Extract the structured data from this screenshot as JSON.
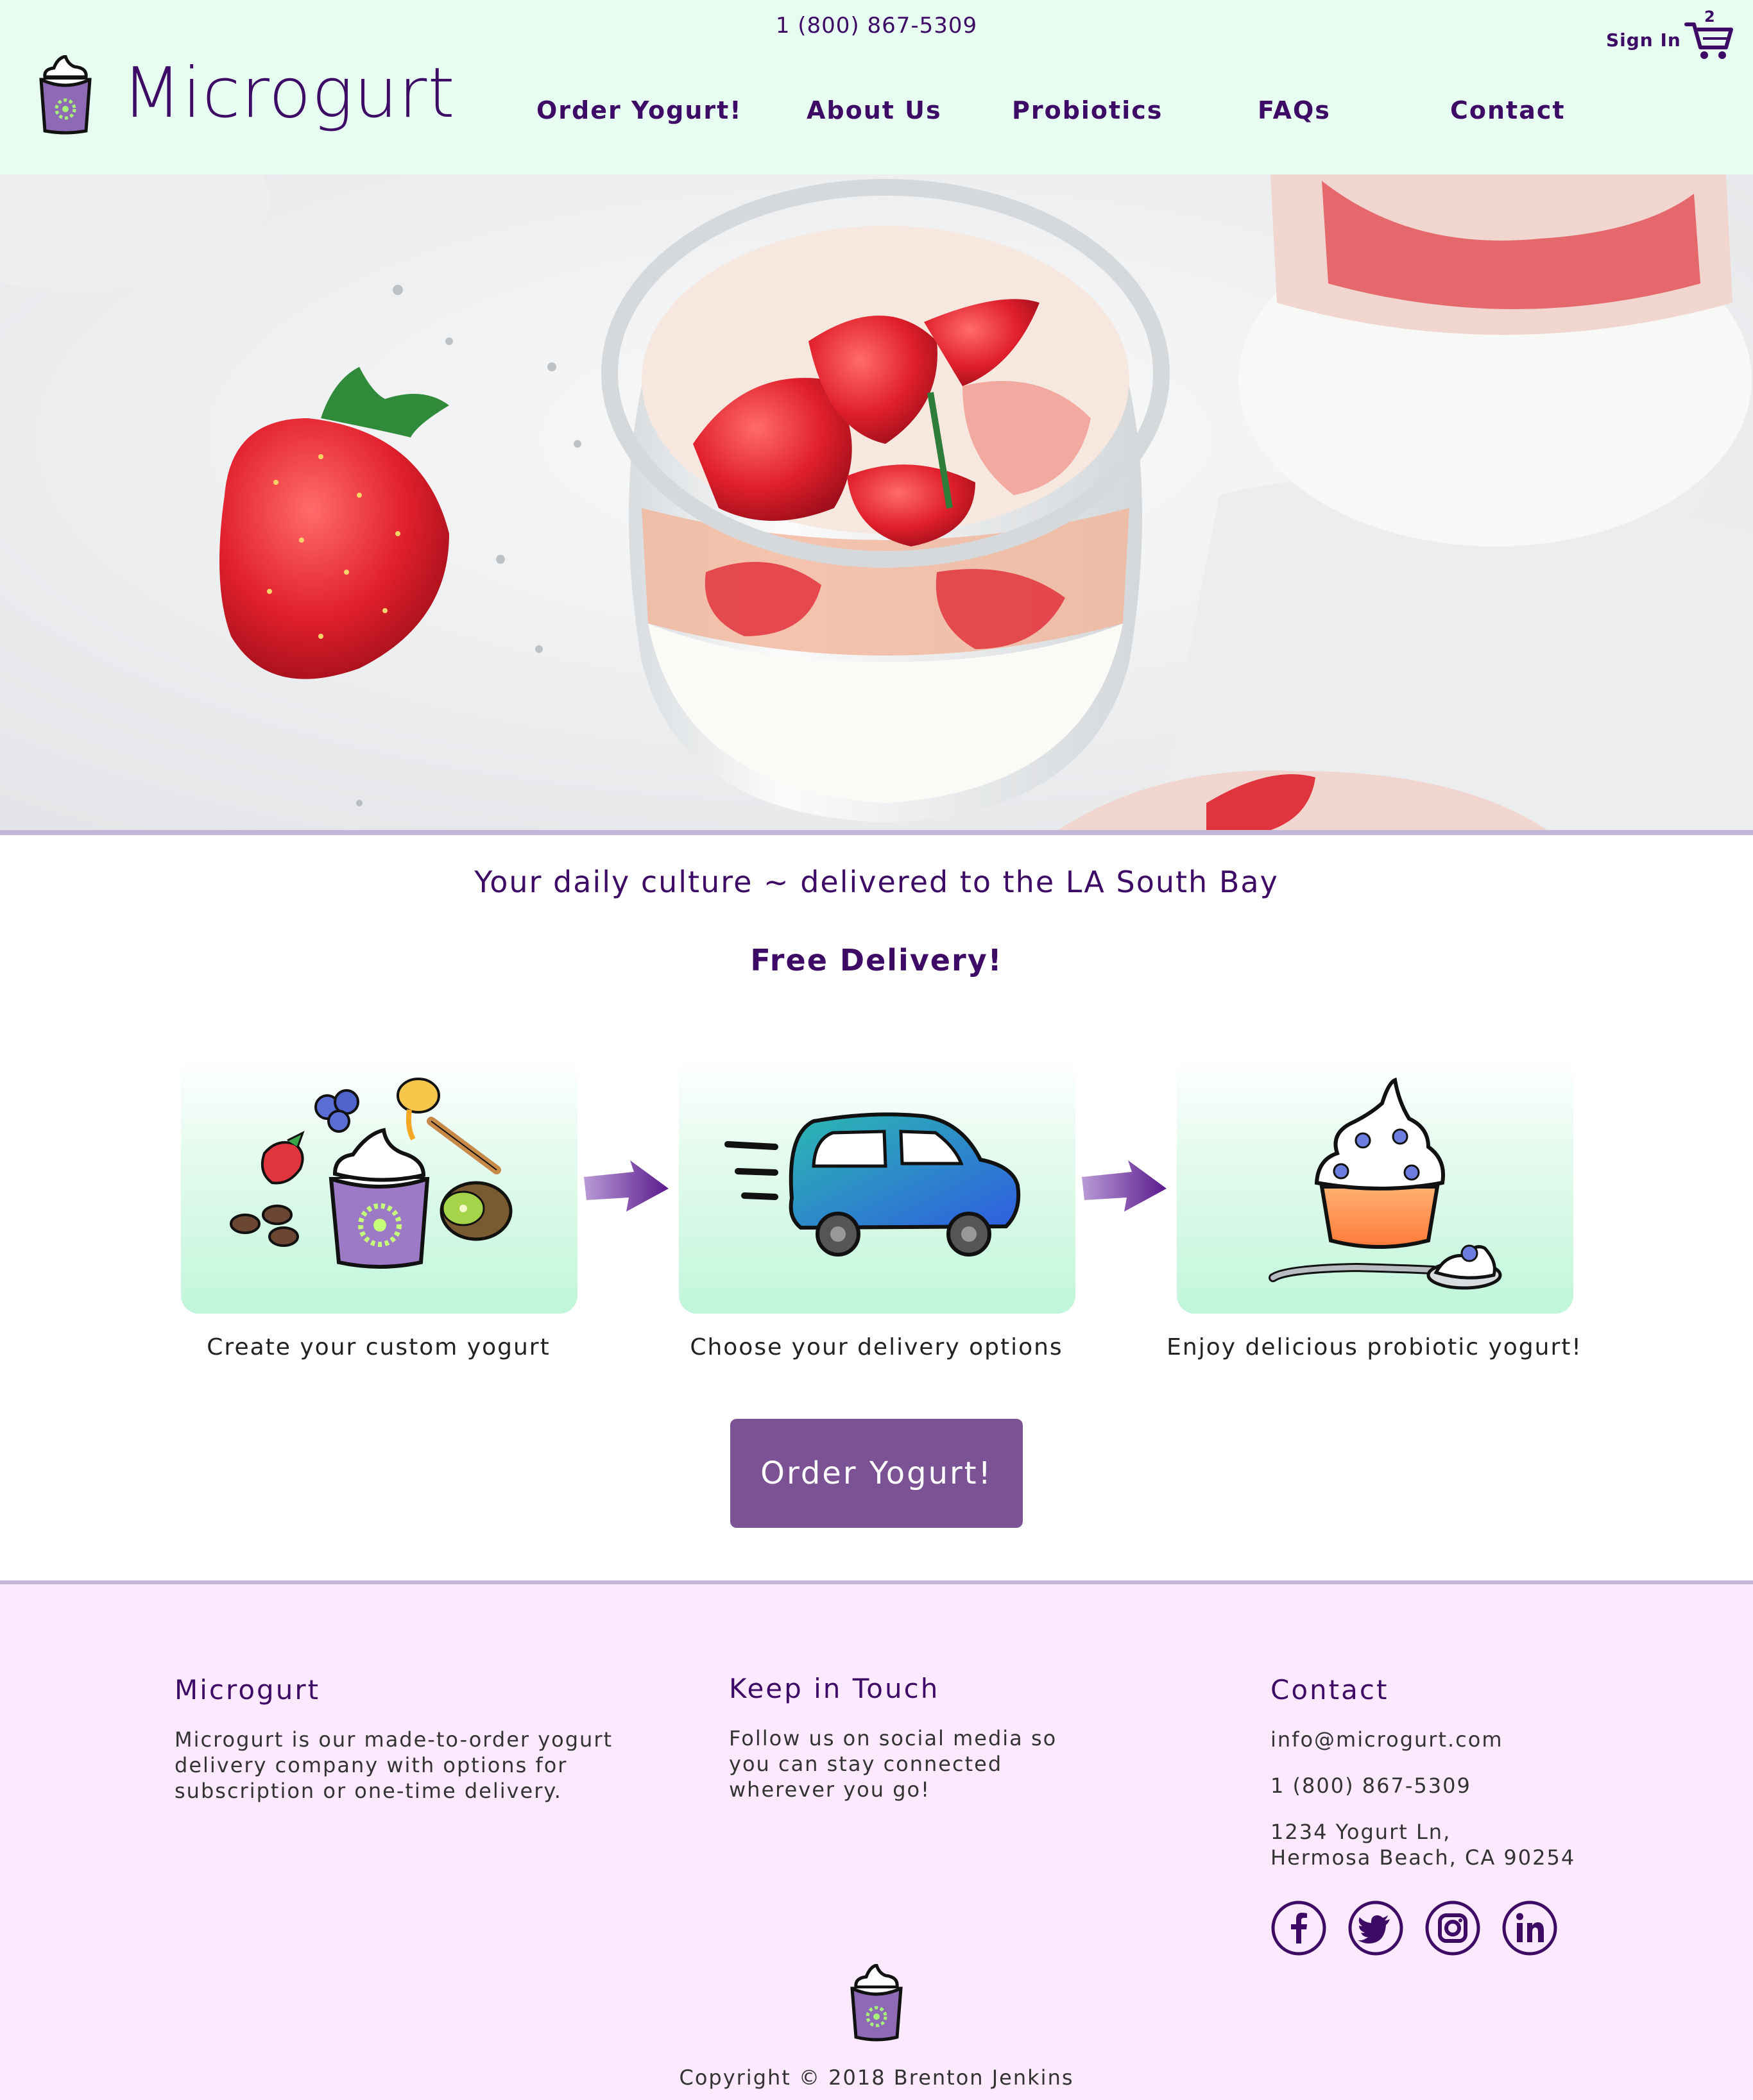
{
  "header": {
    "phone": "1 (800) 867-5309",
    "logo_text": "Microgurt",
    "nav": [
      "Order Yogurt!",
      "About Us",
      "Probiotics",
      "FAQs",
      "Contact"
    ],
    "sign_in": "Sign In",
    "cart_count": "2"
  },
  "main": {
    "tagline": "Your daily culture ~ delivered to the LA South Bay",
    "free_delivery": "Free Delivery!",
    "steps": [
      {
        "caption": "Create your custom yogurt",
        "icon": "yogurt-ingredients-icon"
      },
      {
        "caption": "Choose your delivery options",
        "icon": "car-icon"
      },
      {
        "caption": "Enjoy delicious probiotic yogurt!",
        "icon": "yogurt-cup-spoon-icon"
      }
    ],
    "order_button": "Order Yogurt!"
  },
  "footer": {
    "about_heading": "Microgurt",
    "about_text": "Microgurt is our made-to-order yogurt\ndelivery company with options for\nsubscription or one-time delivery.",
    "touch_heading": "Keep in Touch",
    "touch_text": "Follow us on social media so\nyou can stay connected\nwherever you go!",
    "contact_heading": "Contact",
    "email": "info@microgurt.com",
    "phone": "1 (800) 867-5309",
    "address": "1234 Yogurt Ln,\nHermosa Beach, CA 90254",
    "social": [
      "facebook-icon",
      "twitter-icon",
      "instagram-icon",
      "linkedin-icon"
    ],
    "copyright": "Copyright © 2018 Brenton Jenkins"
  },
  "colors": {
    "brand": "#3d0a66",
    "header_bg": "#e8fdf2",
    "button": "#7b5394",
    "footer_bg": "#fce9fe"
  }
}
